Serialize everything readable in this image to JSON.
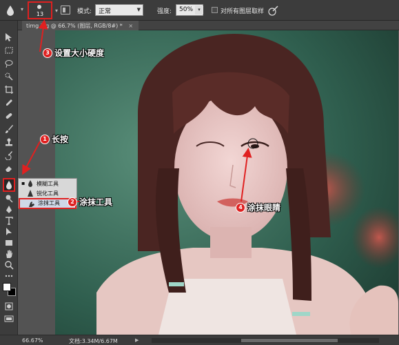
{
  "options_bar": {
    "brush_size": "13",
    "mode_label": "模式:",
    "mode_value": "正常",
    "strength_label": "强度:",
    "strength_value": "50%",
    "sample_all_label": "对所有图层取样"
  },
  "document": {
    "tab_title": "timg.jpg @ 66.7% (图层, RGB/8#) *",
    "tab_close": "×"
  },
  "tool_flyout": {
    "items": [
      {
        "label": "模糊工具",
        "icon": "blur-icon",
        "selected": true
      },
      {
        "label": "锐化工具",
        "icon": "sharpen-icon",
        "selected": false
      },
      {
        "label": "涂抹工具",
        "icon": "smudge-icon",
        "selected": false
      }
    ]
  },
  "annotations": [
    {
      "number": "1",
      "text": "长按"
    },
    {
      "number": "2",
      "text": "涂抹工具"
    },
    {
      "number": "3",
      "text": "设置大小硬度"
    },
    {
      "number": "4",
      "text": "涂抹眼睛"
    }
  ],
  "status_bar": {
    "zoom": "66.67%",
    "doc_size": "文档:3.34M/6.67M",
    "menu_arrow": "▶"
  },
  "colors": {
    "accent_red": "#e02020",
    "ui_dark": "#3c3c3c",
    "ui_mid": "#535353"
  }
}
